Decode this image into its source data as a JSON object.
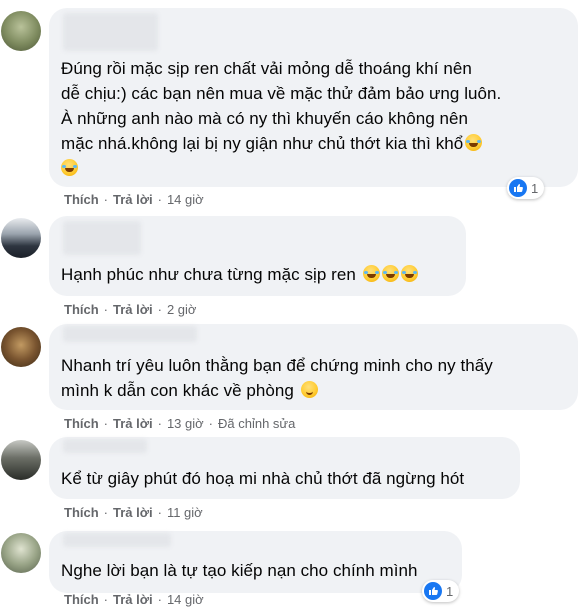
{
  "accent_color": "#1877f2",
  "comments": [
    {
      "lines": [
        "Đúng rồi mặc sịp ren chất vải mỏng dễ thoáng khí nên",
        "dễ chịu:) các bạn nên mua về mặc thử đảm bảo ưng luôn.",
        "À những anh nào mà có ny thì khuyến cáo không nên",
        "mặc nhá.không lại bị ny giận như chủ thớt kia thì khổ",
        ""
      ],
      "like": "Thích",
      "reply": "Trả lời",
      "time": "14 giờ",
      "reaction_count": "1"
    },
    {
      "lines": [
        "Hạnh phúc như chưa từng mặc sịp ren "
      ],
      "like": "Thích",
      "reply": "Trả lời",
      "time": "2 giờ"
    },
    {
      "lines": [
        "Nhanh trí yêu luôn thằng bạn để chứng minh cho ny thấy",
        "mình k dẫn con khác về phòng "
      ],
      "like": "Thích",
      "reply": "Trả lời",
      "time": "13 giờ",
      "edited": "Đã chỉnh sửa"
    },
    {
      "lines": [
        "Kể từ giây phút đó hoạ mi nhà chủ thớt đã ngừng hót"
      ],
      "like": "Thích",
      "reply": "Trả lời",
      "time": "11 giờ"
    },
    {
      "lines": [
        "Nghe lời bạn là tự tạo kiếp nạn cho chính mình"
      ],
      "like": "Thích",
      "reply": "Trả lời",
      "time": "14 giờ",
      "reaction_count": "1"
    }
  ]
}
